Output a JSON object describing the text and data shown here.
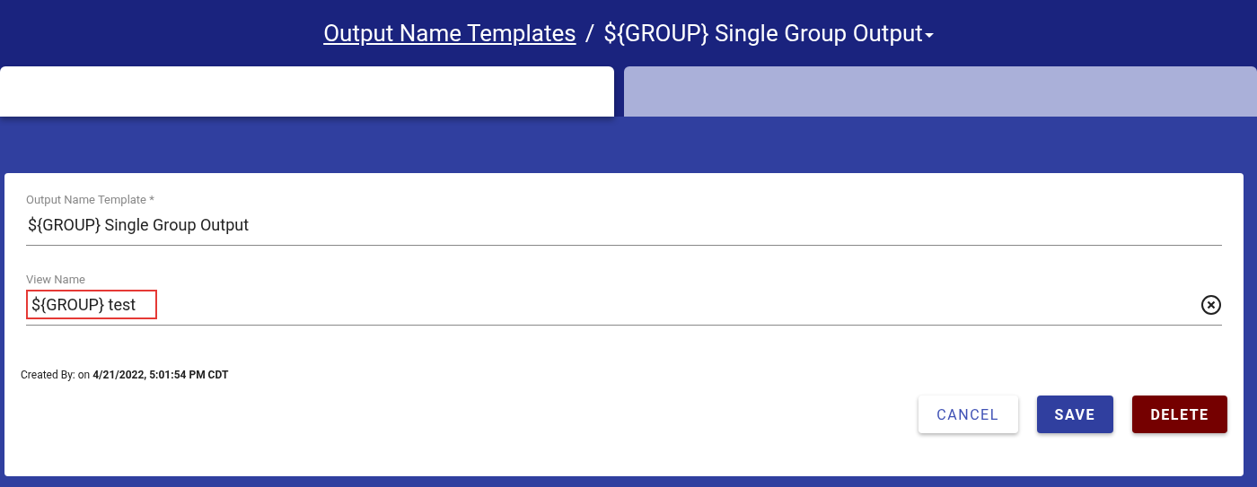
{
  "breadcrumb": {
    "link": "Output Name Templates",
    "separator": "/",
    "current": "${GROUP} Single Group Output"
  },
  "tabs": [
    {
      "selected": true
    },
    {
      "selected": false
    }
  ],
  "fields": [
    {
      "label": "Output Name Template *",
      "value": "${GROUP} Single Group Output",
      "highlighted": false,
      "clearable": false
    },
    {
      "label": "View Name",
      "value": "${GROUP} test",
      "highlighted": true,
      "clearable": true
    }
  ],
  "created": "Created By: on **4/21/2022, 5:01:54 PM CDT**",
  "buttons": [
    {
      "label": "CANCEL",
      "kind": "outlined"
    },
    {
      "label": "SAVE",
      "kind": "primary"
    },
    {
      "label": "DELETE",
      "kind": "danger"
    }
  ]
}
